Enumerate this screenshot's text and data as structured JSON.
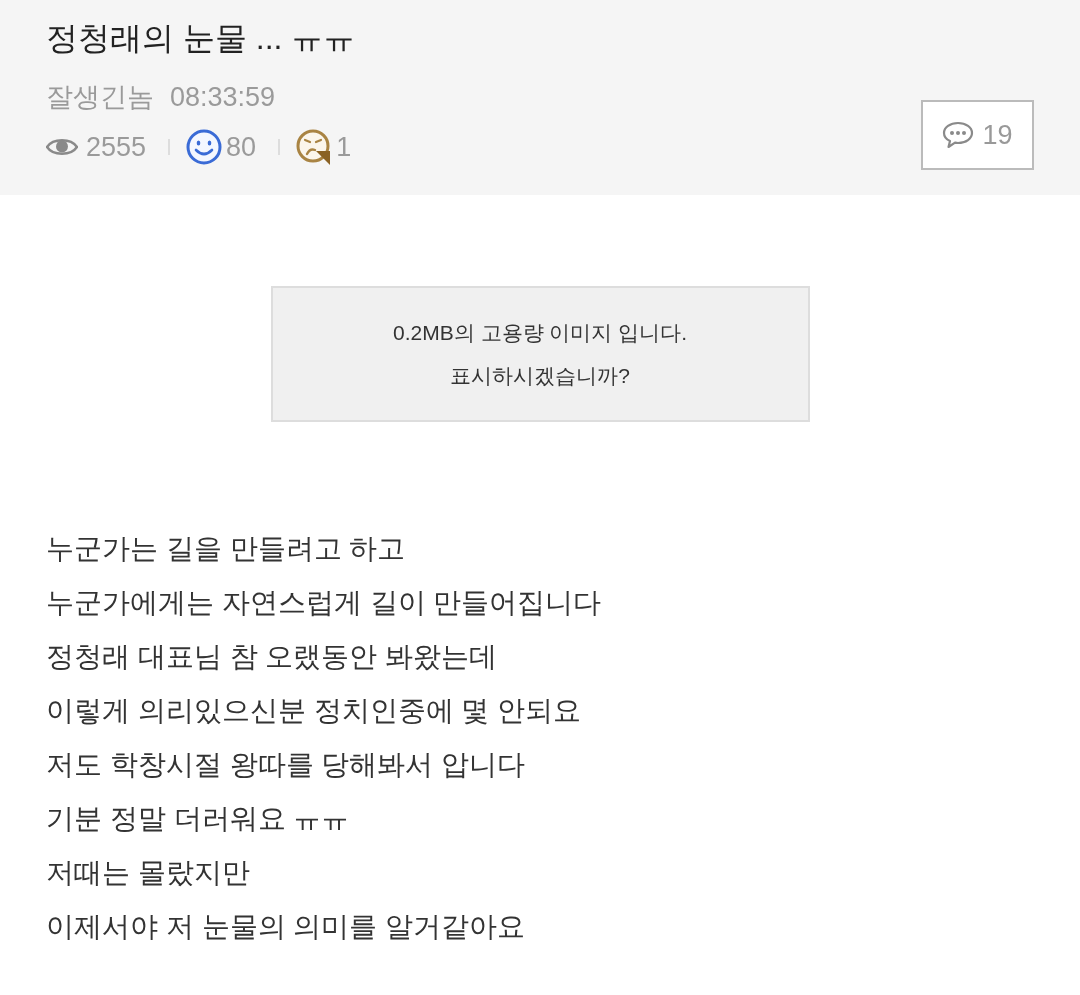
{
  "post": {
    "title": "정청래의 눈물 ... ㅠㅠ",
    "author": "잘생긴놈",
    "time": "08:33:59",
    "stats": {
      "views": "2555",
      "likes": "80",
      "dislikes": "1"
    },
    "comment_count": "19"
  },
  "image_notice": {
    "lines": [
      "0.2MB의 고용량 이미지 입니다.",
      "표시하시겠습니까?"
    ]
  },
  "body": {
    "lines": [
      "누군가는 길을 만들려고 하고",
      "누군가에게는 자연스럽게 길이 만들어집니다",
      "정청래 대표님 참 오랬동안 봐왔는데",
      "이렇게 의리있으신분 정치인중에 몇 안되요",
      "저도 학창시절 왕따를 당해봐서 압니다",
      "기분 정말 더러워요 ㅠㅠ",
      "저때는 몰랐지만",
      "이제서야 저 눈물의 의미를 알거같아요"
    ]
  }
}
